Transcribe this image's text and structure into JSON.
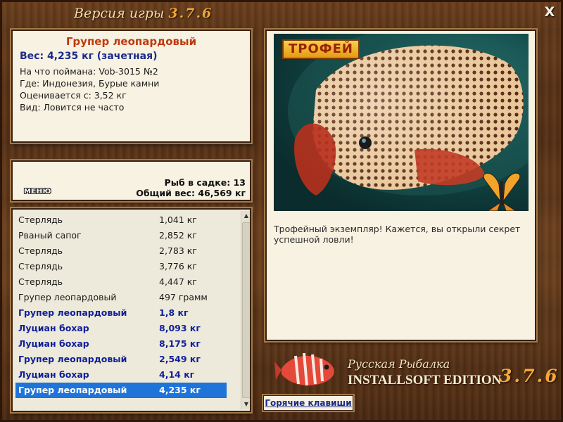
{
  "window": {
    "title_prefix": "Версия игры",
    "title_version": "3.7.6",
    "close_label": "X"
  },
  "info": {
    "fish_name": "Групер леопардовый",
    "weight_line": "Вес: 4,235 кг (зачетная)",
    "lines": [
      "На что поймана: Vob-3015 №2",
      "Где: Индонезия, Бурые камни",
      "Оценивается с: 3,52 кг",
      "Вид: Ловится не часто"
    ]
  },
  "stats": {
    "menu_label": "МЕНЮ",
    "fish_count": "Рыб в садке: 13",
    "total_weight": "Общий вес: 46,569 кг"
  },
  "catch_list": [
    {
      "name": "Стерлядь",
      "weight": "1,041 кг",
      "bold": false,
      "selected": false
    },
    {
      "name": "Рваный сапог",
      "weight": "2,852 кг",
      "bold": false,
      "selected": false
    },
    {
      "name": "Стерлядь",
      "weight": "2,783 кг",
      "bold": false,
      "selected": false
    },
    {
      "name": "Стерлядь",
      "weight": "3,776 кг",
      "bold": false,
      "selected": false
    },
    {
      "name": "Стерлядь",
      "weight": "4,447 кг",
      "bold": false,
      "selected": false
    },
    {
      "name": "Групер леопардовый",
      "weight": "497 грамм",
      "bold": false,
      "selected": false
    },
    {
      "name": "Групер леопардовый",
      "weight": "1,8 кг",
      "bold": true,
      "selected": false
    },
    {
      "name": "Луциан бохар",
      "weight": "8,093 кг",
      "bold": true,
      "selected": false
    },
    {
      "name": "Луциан бохар",
      "weight": "8,175 кг",
      "bold": true,
      "selected": false
    },
    {
      "name": "Групер леопардовый",
      "weight": "2,549 кг",
      "bold": true,
      "selected": false
    },
    {
      "name": "Луциан бохар",
      "weight": "4,14 кг",
      "bold": true,
      "selected": false
    },
    {
      "name": "Групер леопардовый",
      "weight": "4,235 кг",
      "bold": true,
      "selected": true
    }
  ],
  "scrollbar": {
    "up_icon": "▲",
    "down_icon": "▼"
  },
  "trophy": {
    "badge": "ТРОФЕЙ",
    "message": "Трофейный экземпляр! Кажется, вы открыли секрет успешной ловли!"
  },
  "brand": {
    "line1": "Русская Рыбалка",
    "line2": "INSTALLSOFT EDITION",
    "version": "3.7.6"
  },
  "hotkeys_label": "Горячие клавиши",
  "colors": {
    "accent_red": "#c0390e",
    "accent_blue": "#1a2a8a",
    "selection_blue": "#1e74d8",
    "panel_bg": "#f7f2e2",
    "wood": "#5a3216"
  }
}
